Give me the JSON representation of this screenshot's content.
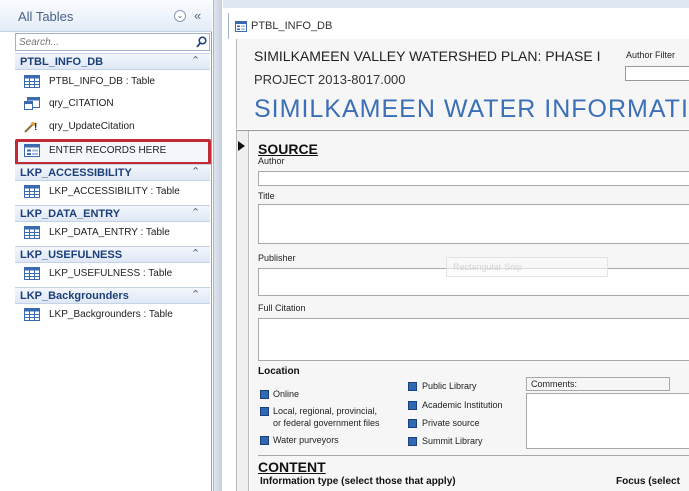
{
  "nav": {
    "title": "All Tables",
    "dropdown_glyph": "⌄",
    "collapse_glyph": "«",
    "search": {
      "placeholder": "Search..."
    },
    "groups": [
      {
        "label": "PTBL_INFO_DB",
        "chevron": "⌃",
        "items": [
          {
            "label": "PTBL_INFO_DB : Table",
            "icon": "table-icon"
          },
          {
            "label": "qry_CITATION",
            "icon": "query-icon"
          },
          {
            "label": "qry_UpdateCitation",
            "icon": "update-query-icon"
          },
          {
            "label": "ENTER RECORDS HERE",
            "icon": "form-icon",
            "highlighted": true
          }
        ]
      },
      {
        "label": "LKP_ACCESSIBILITY",
        "chevron": "⌃",
        "items": [
          {
            "label": "LKP_ACCESSIBILITY : Table",
            "icon": "table-icon"
          }
        ]
      },
      {
        "label": "LKP_DATA_ENTRY",
        "chevron": "⌃",
        "items": [
          {
            "label": "LKP_DATA_ENTRY : Table",
            "icon": "table-icon"
          }
        ]
      },
      {
        "label": "LKP_USEFULNESS",
        "chevron": "⌃",
        "items": [
          {
            "label": "LKP_USEFULNESS : Table",
            "icon": "table-icon"
          }
        ]
      },
      {
        "label": "LKP_Backgrounders",
        "chevron": "⌃",
        "items": [
          {
            "label": "LKP_Backgrounders : Table",
            "icon": "table-icon"
          }
        ]
      }
    ]
  },
  "document": {
    "tab_label": "PTBL_INFO_DB",
    "header": {
      "title": "SIMILKAMEEN VALLEY WATERSHED PLAN: PHASE I",
      "author_filter_label": "Author Filter",
      "author_filter_value": "",
      "project": "PROJECT 2013-8017.000",
      "banner": "SIMILKAMEEN WATER INFORMATION"
    },
    "record_selector": "▶",
    "source": {
      "heading": "SOURCE",
      "author_label": "Author",
      "title_label": "Title",
      "publisher_label": "Publisher",
      "full_citation_label": "Full Citation",
      "snip_overlay": "Rectangular Snip"
    },
    "location": {
      "label": "Location",
      "options_col1": [
        "Online",
        "Local, regional, provincial,",
        "or federal government files",
        "Water purveyors"
      ],
      "options_col2": [
        "Public Library",
        "Academic Institution",
        "Private source",
        "Summit Library"
      ],
      "comments_label": "Comments:"
    },
    "content": {
      "heading": "CONTENT",
      "info_type": "Information type (select those that apply)",
      "focus": "Focus (select"
    }
  },
  "colors": {
    "group_label": "#1c3f79",
    "banner": "#3b6fb7",
    "highlight_box": "#c42a36",
    "checkbox_fill": "#2f68b3"
  }
}
